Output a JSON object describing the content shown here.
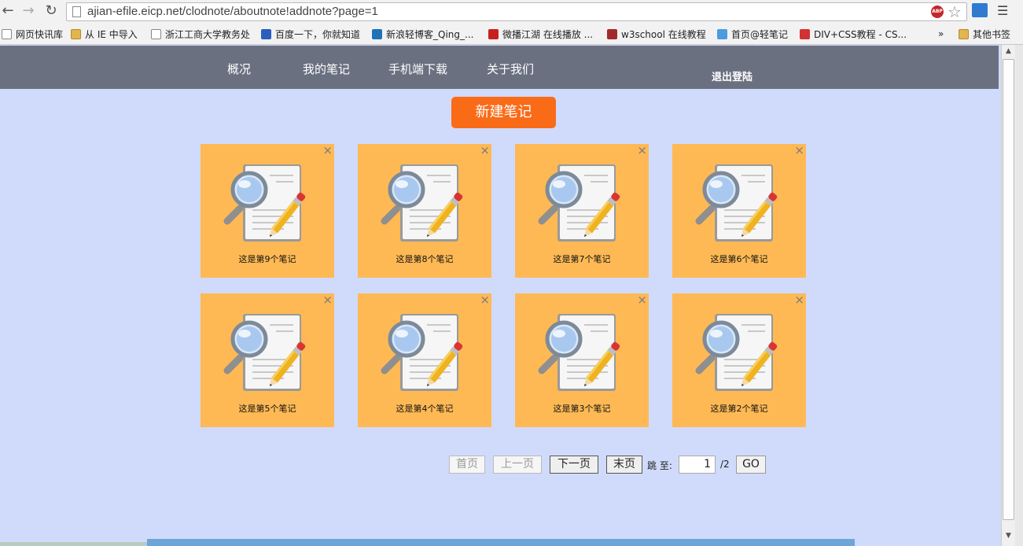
{
  "browser": {
    "url": "ajian-efile.eicp.net/clodnote/aboutnote!addnote?page=1",
    "abp_label": "ABP",
    "overflow": "»",
    "bookmarks": [
      {
        "label": "网页快讯库",
        "icon": "page"
      },
      {
        "label": "从 IE 中导入",
        "icon": "folder"
      },
      {
        "label": "浙江工商大学教务处",
        "icon": "page"
      },
      {
        "label": "百度一下，你就知道",
        "icon": "blue"
      },
      {
        "label": "新浪轻博客_Qing_...",
        "icon": "sina"
      },
      {
        "label": "微播江湖 在线播放 ...",
        "icon": "w56"
      },
      {
        "label": "w3school 在线教程",
        "icon": "w3"
      },
      {
        "label": "首页@轻笔记",
        "icon": "cloud"
      },
      {
        "label": "DIV+CSS教程 - CS...",
        "icon": "five"
      },
      {
        "label": "其他书签",
        "icon": "folder"
      }
    ]
  },
  "nav": {
    "items": [
      "概况",
      "我的笔记",
      "手机端下载",
      "关于我们"
    ],
    "logout": "退出登陆"
  },
  "new_note_label": "新建笔记",
  "notes": [
    {
      "label": "这是第9个笔记"
    },
    {
      "label": "这是第8个笔记"
    },
    {
      "label": "这是第7个笔记"
    },
    {
      "label": "这是第6个笔记"
    },
    {
      "label": "这是第5个笔记"
    },
    {
      "label": "这是第4个笔记"
    },
    {
      "label": "这是第3个笔记"
    },
    {
      "label": "这是第2个笔记"
    }
  ],
  "close_glyph": "×",
  "pager": {
    "first": "首页",
    "prev": "上一页",
    "next": "下一页",
    "last": "末页",
    "jump_label": "跳 至:",
    "page_value": "1",
    "total": "/2",
    "go": "GO"
  },
  "colors": {
    "page_bg": "#d0dbfb",
    "nav_bg": "#6a7080",
    "new_button": "#fa6b18",
    "card_bg": "#feb955"
  }
}
